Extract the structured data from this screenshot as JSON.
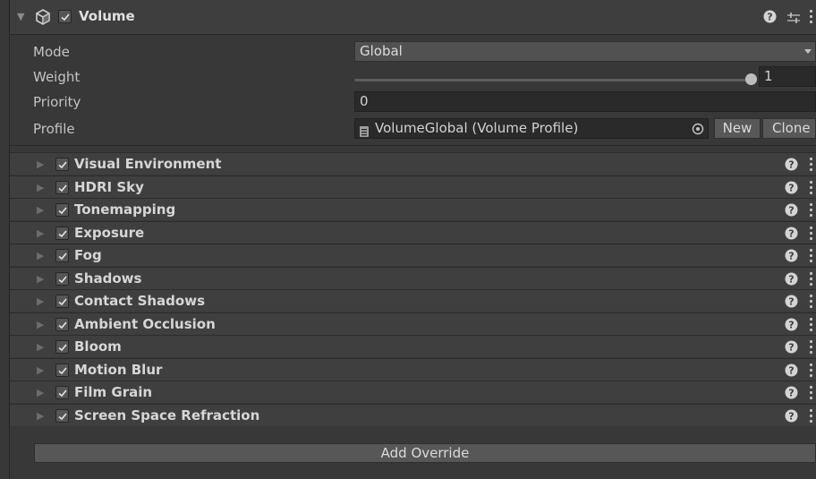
{
  "component": {
    "title": "Volume",
    "enabled": true,
    "icons": [
      "cube-icon",
      "help-icon",
      "preset-icon",
      "kebab-menu-icon"
    ]
  },
  "properties": {
    "mode": {
      "label": "Mode",
      "value": "Global"
    },
    "weight": {
      "label": "Weight",
      "value": "1",
      "slider_fraction": 1.0
    },
    "priority": {
      "label": "Priority",
      "value": "0"
    },
    "profile": {
      "label": "Profile",
      "value": "VolumeGlobal (Volume Profile)",
      "new_label": "New",
      "clone_label": "Clone"
    }
  },
  "overrides": [
    {
      "label": "Visual Environment",
      "enabled": true
    },
    {
      "label": "HDRI Sky",
      "enabled": true
    },
    {
      "label": "Tonemapping",
      "enabled": true
    },
    {
      "label": "Exposure",
      "enabled": true
    },
    {
      "label": "Fog",
      "enabled": true
    },
    {
      "label": "Shadows",
      "enabled": true
    },
    {
      "label": "Contact Shadows",
      "enabled": true
    },
    {
      "label": "Ambient Occlusion",
      "enabled": true
    },
    {
      "label": "Bloom",
      "enabled": true
    },
    {
      "label": "Motion Blur",
      "enabled": true
    },
    {
      "label": "Film Grain",
      "enabled": true
    },
    {
      "label": "Screen Space Refraction",
      "enabled": true
    }
  ],
  "add_override_label": "Add Override",
  "colors": {
    "background": "#383838",
    "header": "#3e3e3e",
    "field": "#2a2a2a",
    "button": "#585858",
    "text": "#c4c4c4"
  }
}
